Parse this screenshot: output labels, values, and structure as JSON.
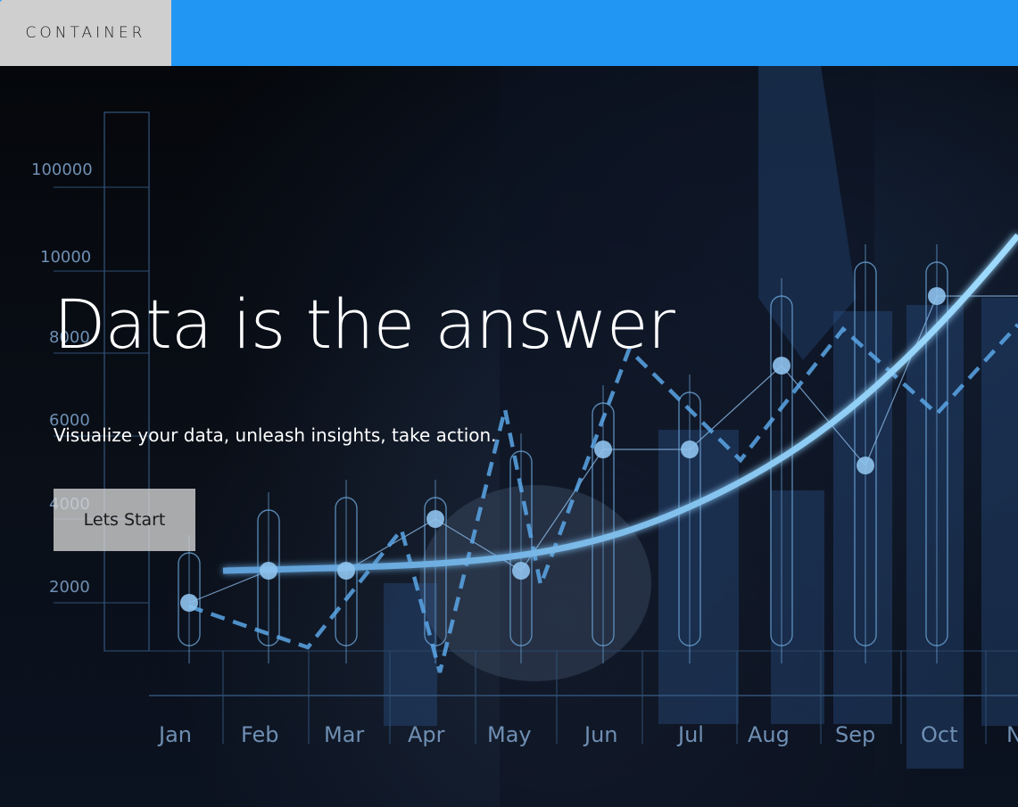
{
  "header": {
    "brand": "CONTAINER",
    "accent_color": "#2196f3",
    "brand_bg": "#cfcfcf"
  },
  "hero": {
    "title": "Data is the answer",
    "subtitle": "Visualize your data, unleash insights, take action.",
    "cta_label": "Lets Start"
  },
  "background_chart": {
    "y_ticks": [
      "100000",
      "10000",
      "8000",
      "6000",
      "4000",
      "2000"
    ],
    "months": [
      "Jan",
      "Feb",
      "Mar",
      "Apr",
      "May",
      "Jun",
      "Jul",
      "Aug",
      "Sep",
      "Oct",
      "N"
    ]
  }
}
